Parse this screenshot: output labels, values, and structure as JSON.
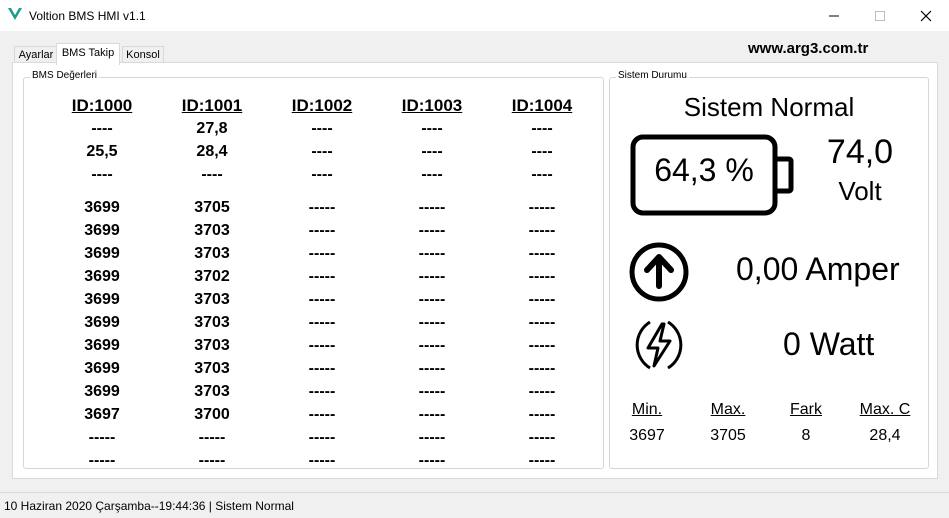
{
  "window": {
    "title": "Voltion BMS HMI v1.1",
    "accent": "#1a9e8e"
  },
  "tabs": [
    {
      "label": "Ayarlar"
    },
    {
      "label": "BMS Takip"
    },
    {
      "label": "Konsol"
    }
  ],
  "website": "www.arg3.com.tr",
  "bms": {
    "group_title": "BMS Değerleri",
    "columns": [
      {
        "id": "ID:1000",
        "top": [
          "----",
          "25,5",
          "----"
        ],
        "cells": [
          "3699",
          "3699",
          "3699",
          "3699",
          "3699",
          "3699",
          "3699",
          "3699",
          "3699",
          "3697",
          "-----",
          "-----"
        ]
      },
      {
        "id": "ID:1001",
        "top": [
          "27,8",
          "28,4",
          "----"
        ],
        "cells": [
          "3705",
          "3703",
          "3703",
          "3702",
          "3703",
          "3703",
          "3703",
          "3703",
          "3703",
          "3700",
          "-----",
          "-----"
        ]
      },
      {
        "id": "ID:1002",
        "top": [
          "----",
          "----",
          "----"
        ],
        "cells": [
          "-----",
          "-----",
          "-----",
          "-----",
          "-----",
          "-----",
          "-----",
          "-----",
          "-----",
          "-----",
          "-----",
          "-----"
        ]
      },
      {
        "id": "ID:1003",
        "top": [
          "----",
          "----",
          "----"
        ],
        "cells": [
          "-----",
          "-----",
          "-----",
          "-----",
          "-----",
          "-----",
          "-----",
          "-----",
          "-----",
          "-----",
          "-----",
          "-----"
        ]
      },
      {
        "id": "ID:1004",
        "top": [
          "----",
          "----",
          "----"
        ],
        "cells": [
          "-----",
          "-----",
          "-----",
          "-----",
          "-----",
          "-----",
          "-----",
          "-----",
          "-----",
          "-----",
          "-----",
          "-----"
        ]
      }
    ]
  },
  "system": {
    "group_title": "Sistem Durumu",
    "status": "Sistem Normal",
    "soc": "64,3 %",
    "voltage": "74,0",
    "voltage_unit": "Volt",
    "current": "0,00 Amper",
    "power": "0 Watt",
    "stats": {
      "min_label": "Min.",
      "min_value": "3697",
      "max_label": "Max.",
      "max_value": "3705",
      "diff_label": "Fark",
      "diff_value": "8",
      "maxc_label": "Max. C",
      "maxc_value": "28,4"
    }
  },
  "statusbar": {
    "text": "10 Haziran 2020 Çarşamba--19:44:36  |  Sistem Normal"
  }
}
